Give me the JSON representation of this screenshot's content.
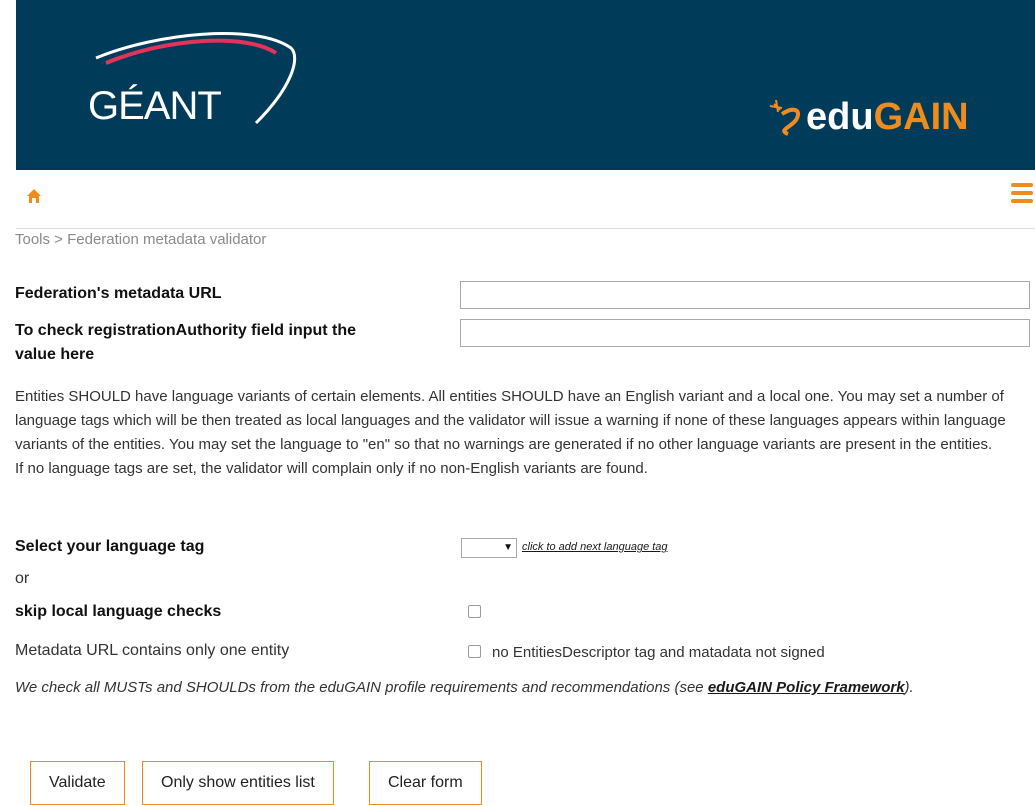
{
  "header": {
    "logo_left": "GÉANT",
    "logo_right_edu": "edu",
    "logo_right_gain": "GAIN"
  },
  "nav": {
    "home_icon": "home-icon",
    "menu_icon": "hamburger-menu-icon"
  },
  "breadcrumb": "Tools > Federation metadata validator",
  "form": {
    "metadata_url_label": "Federation's metadata URL",
    "metadata_url_value": "",
    "reg_authority_label_line1": "To check registrationAuthority field input the",
    "reg_authority_label_line2": "value here",
    "reg_authority_value": "",
    "info_paragraph": "Entities SHOULD have language variants of certain elements. All entities SHOULD have an English variant and a local one. You may set a number of language tags which will be then treated as local languages and the validator will issue a warning if none of these languages appears within language variants of the entities. You may set the language to \"en\" so that no warnings are generated if no other language variants are present in the entities.",
    "info_paragraph_2": "If no language tags are set, the validator will complain only if no non-English variants are found.",
    "language_tag_label": "Select your language tag",
    "language_tag_value": "",
    "add_language_link": "click to add next language tag",
    "or_text": "or",
    "skip_checks_label": "skip local language checks",
    "one_entity_label": "Metadata URL contains only one entity",
    "one_entity_checkbox_label": "no EntitiesDescriptor tag and matadata not signed",
    "note_text": "We check all MUSTs and SHOULDs from the eduGAIN profile requirements and recommendations (see ",
    "note_link": "eduGAIN Policy Framework",
    "note_end": ")."
  },
  "buttons": {
    "validate": "Validate",
    "only_entities": "Only show entities list",
    "clear": "Clear form"
  },
  "colors": {
    "header_bg": "#003c5a",
    "accent": "#f08c1e"
  }
}
